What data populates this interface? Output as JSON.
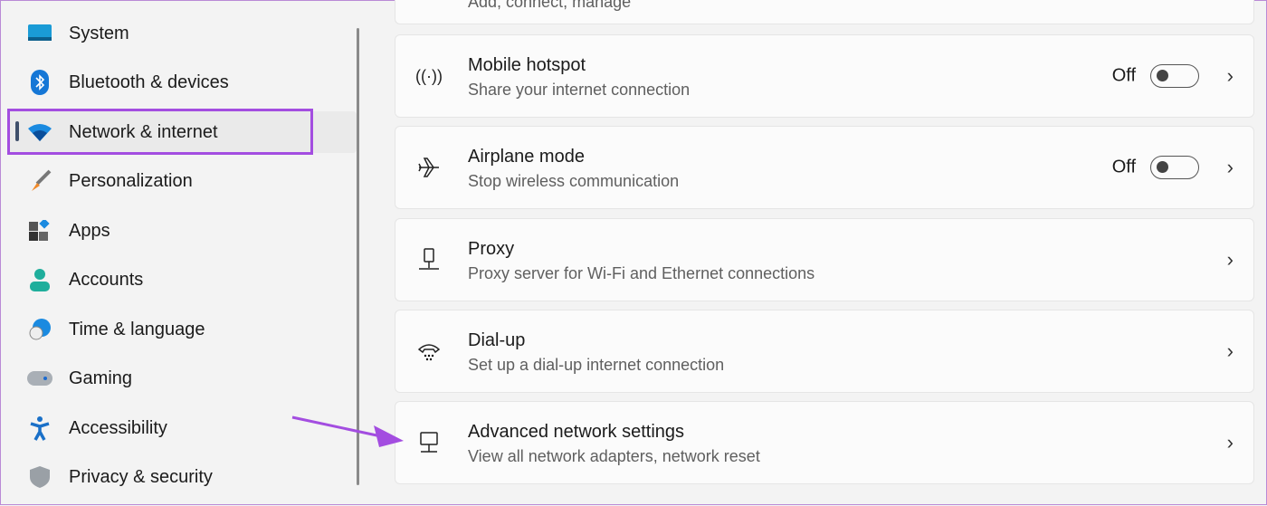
{
  "sidebar": {
    "items": [
      {
        "label": "System",
        "icon": "monitor-icon"
      },
      {
        "label": "Bluetooth & devices",
        "icon": "bluetooth-icon"
      },
      {
        "label": "Network & internet",
        "icon": "wifi-icon",
        "selected": true
      },
      {
        "label": "Personalization",
        "icon": "brush-icon"
      },
      {
        "label": "Apps",
        "icon": "apps-icon"
      },
      {
        "label": "Accounts",
        "icon": "person-icon"
      },
      {
        "label": "Time & language",
        "icon": "globe-clock-icon"
      },
      {
        "label": "Gaming",
        "icon": "gamepad-icon"
      },
      {
        "label": "Accessibility",
        "icon": "accessibility-icon"
      },
      {
        "label": "Privacy & security",
        "icon": "shield-icon"
      }
    ]
  },
  "main": {
    "partial_subtitle": "Add, connect, manage",
    "cards": [
      {
        "title": "Mobile hotspot",
        "subtitle": "Share your internet connection",
        "state": "Off",
        "icon": "hotspot-icon"
      },
      {
        "title": "Airplane mode",
        "subtitle": "Stop wireless communication",
        "state": "Off",
        "icon": "airplane-icon"
      },
      {
        "title": "Proxy",
        "subtitle": "Proxy server for Wi-Fi and Ethernet connections",
        "icon": "proxy-icon"
      },
      {
        "title": "Dial-up",
        "subtitle": "Set up a dial-up internet connection",
        "icon": "dialup-icon"
      },
      {
        "title": "Advanced network settings",
        "subtitle": "View all network adapters, network reset",
        "icon": "network-adapter-icon"
      }
    ]
  },
  "colors": {
    "highlight": "#a34de0",
    "accent": "#0067c0"
  }
}
